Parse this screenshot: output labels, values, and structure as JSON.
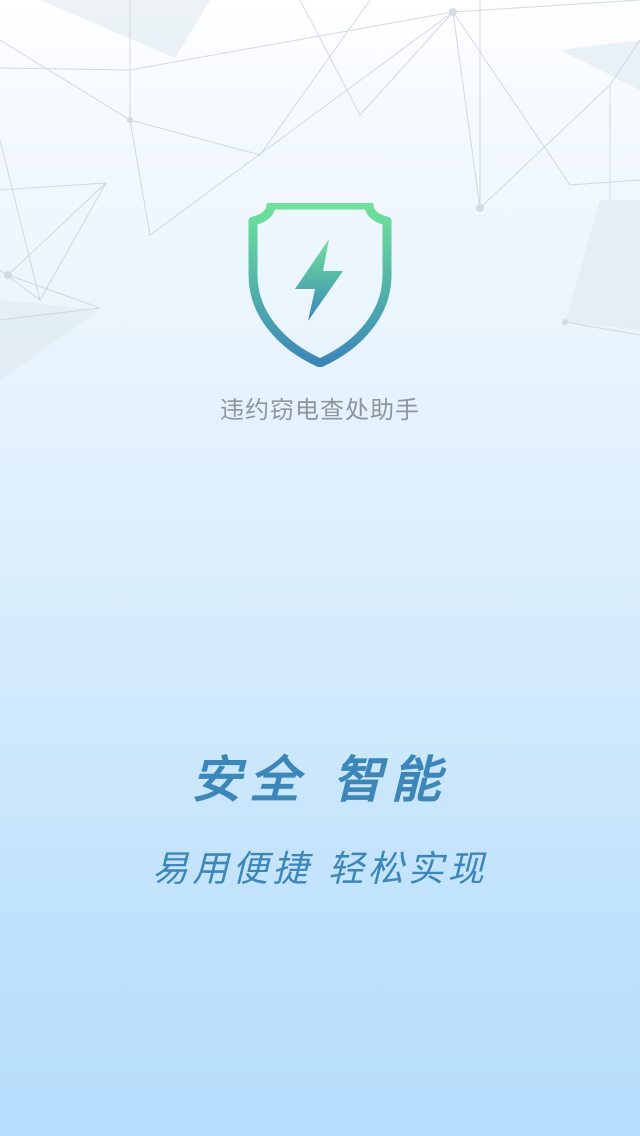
{
  "app": {
    "name": "违约窃电查处助手",
    "logo_icon": "shield-lightning-icon"
  },
  "slogan": {
    "line1": "安全 智能",
    "line2": "易用便捷 轻松实现"
  },
  "colors": {
    "logo_gradient_top": "#6fe39a",
    "logo_gradient_bottom": "#3b86b9",
    "slogan_text": "#3c86ba",
    "app_name_text": "#8e969c",
    "background_top": "#ffffff",
    "background_bottom": "#b5ddfc"
  }
}
